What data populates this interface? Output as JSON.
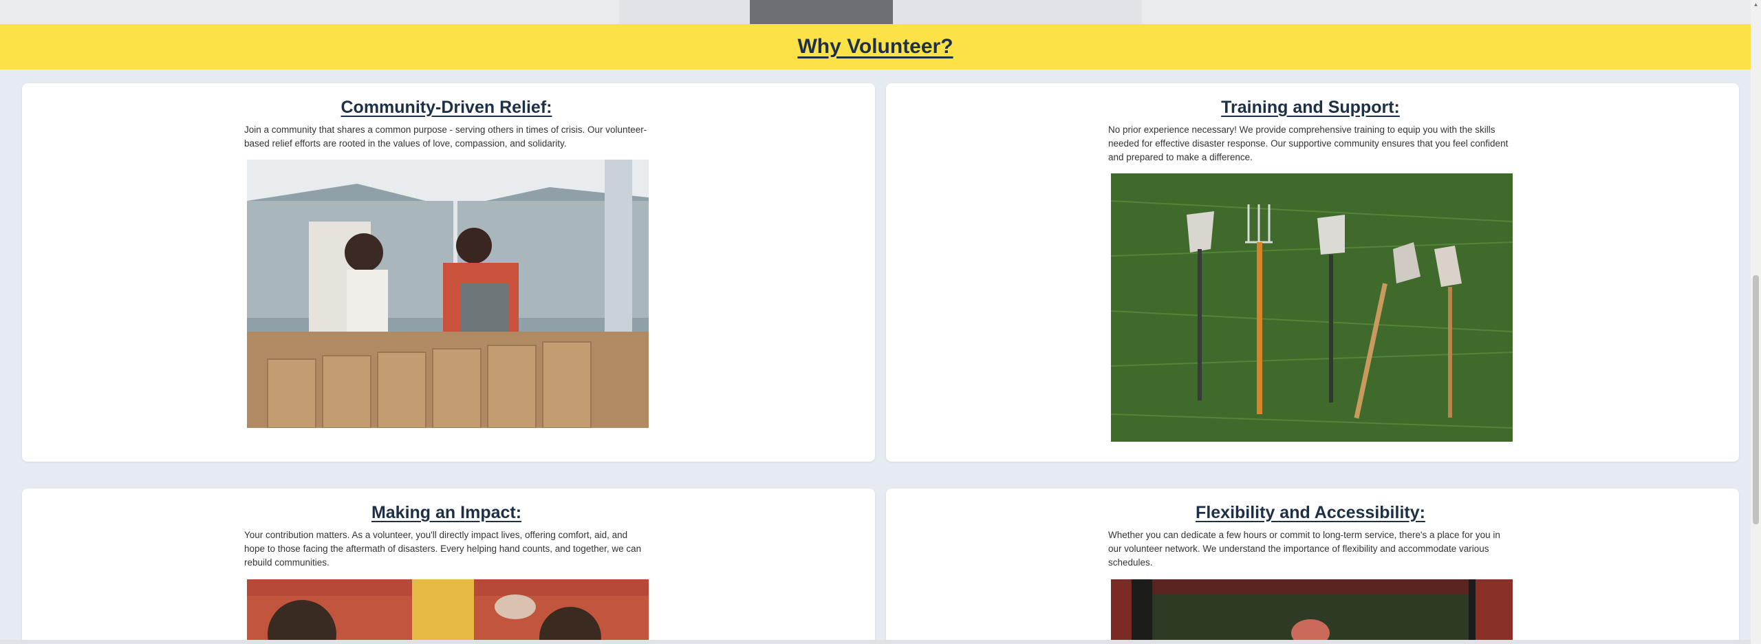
{
  "banner": {
    "title": "Why Volunteer?"
  },
  "cards": [
    {
      "title": "Community-Driven Relief:",
      "body": "Join a community that shares a common purpose - serving others in times of crisis. Our volunteer-based relief efforts are rooted in the values of love, compassion, and solidarity."
    },
    {
      "title": "Training and Support:",
      "body": "No prior experience necessary! We provide comprehensive training to equip you with the skills needed for effective disaster response. Our supportive community ensures that you feel confident and prepared to make a difference."
    },
    {
      "title": "Making an Impact:",
      "body": "Your contribution matters. As a volunteer, you'll directly impact lives, offering comfort, aid, and hope to those facing the aftermath of disasters. Every helping hand counts, and together, we can rebuild communities."
    },
    {
      "title": "Flexibility and Accessibility:",
      "body": "Whether you can dedicate a few hours or commit to long-term service, there's a place for you in our volunteer network. We understand the importance of flexibility and accommodate various schedules."
    }
  ],
  "colors": {
    "banner": "#fce246",
    "heading": "#1e3045",
    "page_bg": "#e6ebf1",
    "card_bg": "#ffffff"
  }
}
